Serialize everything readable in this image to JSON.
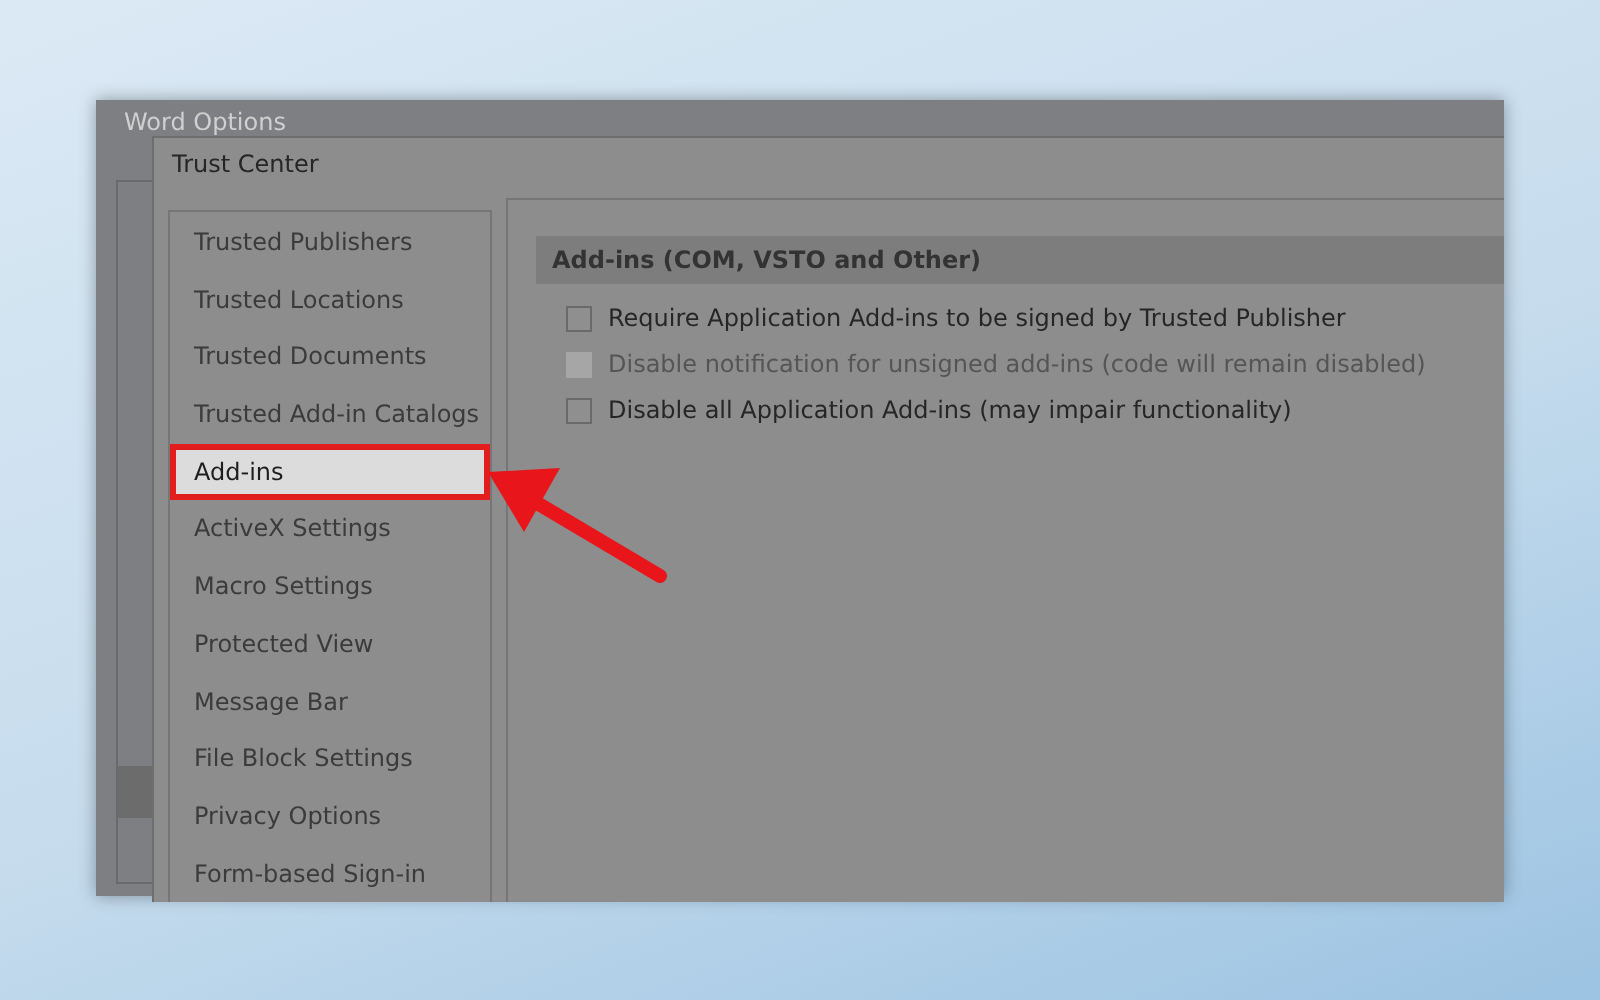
{
  "back_window": {
    "title": "Word Options"
  },
  "dialog": {
    "title": "Trust Center"
  },
  "nav": [
    {
      "label": "Trusted Publishers",
      "selected": false
    },
    {
      "label": "Trusted Locations",
      "selected": false
    },
    {
      "label": "Trusted Documents",
      "selected": false
    },
    {
      "label": "Trusted Add-in Catalogs",
      "selected": false
    },
    {
      "label": "Add-ins",
      "selected": true
    },
    {
      "label": "ActiveX Settings",
      "selected": false
    },
    {
      "label": "Macro Settings",
      "selected": false
    },
    {
      "label": "Protected View",
      "selected": false
    },
    {
      "label": "Message Bar",
      "selected": false
    },
    {
      "label": "File Block Settings",
      "selected": false
    },
    {
      "label": "Privacy Options",
      "selected": false
    },
    {
      "label": "Form-based Sign-in",
      "selected": false
    }
  ],
  "section": {
    "heading": "Add-ins (COM, VSTO and Other)",
    "options": [
      {
        "label": "Require Application Add-ins to be signed by Trusted Publisher",
        "checked": false,
        "disabled": false
      },
      {
        "label": "Disable notification for unsigned add-ins (code will remain disabled)",
        "checked": false,
        "disabled": true
      },
      {
        "label": "Disable all Application Add-ins (may impair functionality)",
        "checked": false,
        "disabled": false
      }
    ]
  }
}
